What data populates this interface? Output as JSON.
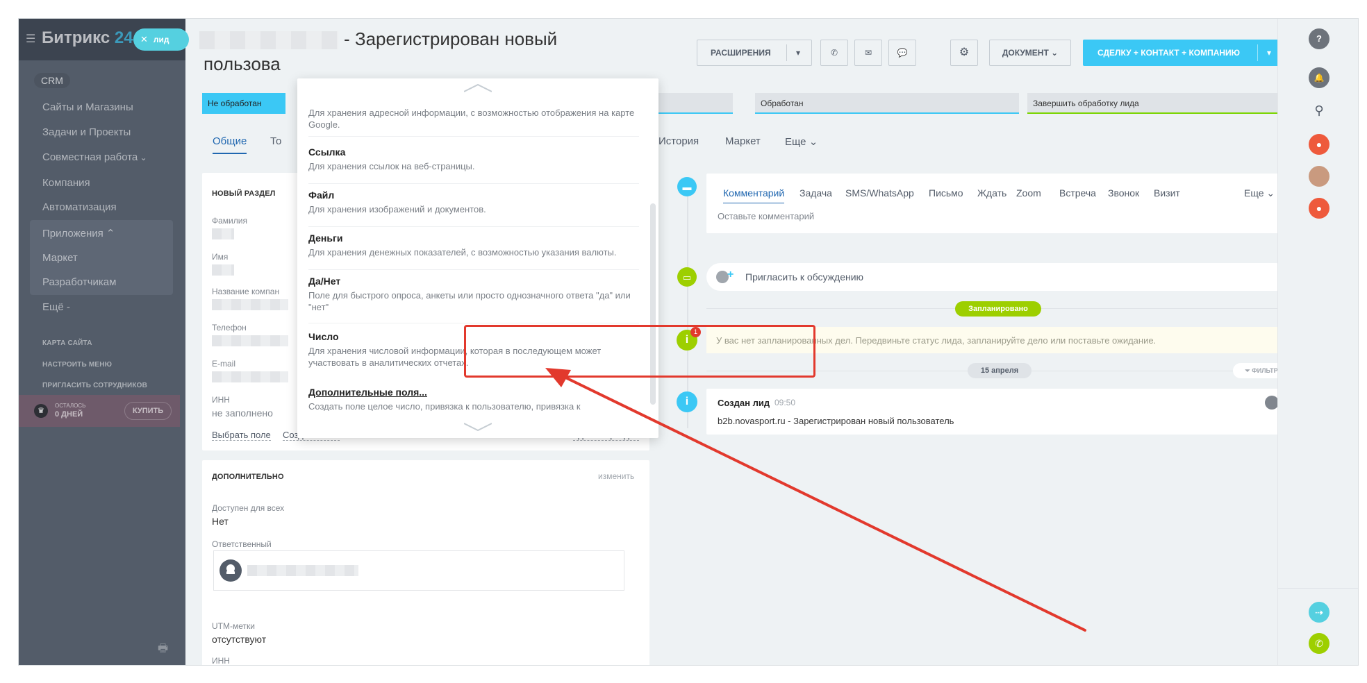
{
  "sidebar": {
    "logo_text": "Битрикс",
    "logo_num": "24",
    "lead_chip": "лид",
    "crm_label": "CRM",
    "items": [
      {
        "label": "Сайты и Магазины"
      },
      {
        "label": "Задачи и Проекты"
      },
      {
        "label": "Совместная работа"
      },
      {
        "label": "Компания"
      },
      {
        "label": "Автоматизация"
      },
      {
        "label": "Приложения"
      },
      {
        "label": "Маркет"
      },
      {
        "label": "Разработчикам"
      },
      {
        "label": "Ещё -"
      }
    ],
    "small_links": [
      "КАРТА САЙТА",
      "НАСТРОИТЬ МЕНЮ",
      "ПРИГЛАСИТЬ СОТРУДНИКОВ"
    ],
    "trial_line1": "ОСТАЛОСЬ",
    "trial_line2": "0 ДНЕЙ",
    "buy_label": "КУПИТЬ"
  },
  "header": {
    "title": "- Зарегистрирован новый",
    "title_line2": "пользова",
    "buttons": {
      "extensions": "РАСШИРЕНИЯ",
      "document": "ДОКУМЕНТ",
      "create": "СДЕЛКУ + КОНТАКТ + КОМПАНИЮ"
    }
  },
  "stages": [
    {
      "label": "Не обработан"
    },
    {
      "label": "Обработан"
    },
    {
      "label": "Завершить обработку лида"
    }
  ],
  "tabs": {
    "general": "Общие",
    "partial": "То",
    "history": "История",
    "market": "Маркет",
    "more": "Еще"
  },
  "left_panel": {
    "section_title": "НОВЫЙ РАЗДЕЛ",
    "fields": [
      {
        "label": "Фамилия"
      },
      {
        "label": "Имя"
      },
      {
        "label": "Название компан"
      },
      {
        "label": "Телефон"
      },
      {
        "label": "E-mail"
      },
      {
        "label": "ИНН",
        "value": "не заполнено"
      }
    ],
    "select_field": "Выбрать поле",
    "create_field": "Создать поле",
    "delete_section": "Удалить раздел",
    "extra_title": "ДОПОЛНИТЕЛЬНО",
    "extra_edit": "изменить",
    "available_label": "Доступен для всех",
    "available_value": "Нет",
    "responsible_label": "Ответственный",
    "utm_label": "UTM-метки",
    "utm_value": "отсутствуют",
    "inn_label": "ИНН"
  },
  "dropdown": {
    "partial_desc": "Для хранения адресной информации, с возможностью отображения на карте Google.",
    "items": [
      {
        "title": "Ссылка",
        "desc": "Для хранения ссылок на веб-страницы."
      },
      {
        "title": "Файл",
        "desc": "Для хранения изображений и документов."
      },
      {
        "title": "Деньги",
        "desc": "Для хранения денежных показателей, с возможностью указания валюты."
      },
      {
        "title": "Да/Нет",
        "desc": "Поле для быстрого опроса, анкеты или просто однозначного ответа \"да\" или \"нет\""
      },
      {
        "title": "Число",
        "desc": "Для хранения числовой информации, которая в последующем может участвовать в аналитических отчетах."
      },
      {
        "title": "Дополнительные поля...",
        "desc": "Создать поле целое число, привязка к пользователю, привязка к"
      }
    ]
  },
  "timeline": {
    "comment_tabs": [
      "Комментарий",
      "Задача",
      "SMS/WhatsApp",
      "Письмо",
      "Ждать",
      "Zoom",
      "Встреча",
      "Звонок",
      "Визит"
    ],
    "comment_more": "Еще",
    "comment_placeholder": "Оставьте комментарий",
    "invite": "Пригласить к обсуждению",
    "planned_badge": "Запланировано",
    "planned_notice": "У вас нет запланированных дел. Передвиньте статус лида, запланируйте дело или поставьте ожидание.",
    "notice_count": "1",
    "date_badge": "15 апреля",
    "filter_label": "ФИЛЬТР",
    "event_title": "Создан лид",
    "event_time": "09:50",
    "event_text": "b2b.novasport.ru - Зарегистрирован новый пользователь"
  },
  "colors": {
    "accent": "#3bc8f5",
    "link": "#2067b0",
    "highlight": "#e2392d",
    "planned": "#9dcf00"
  }
}
